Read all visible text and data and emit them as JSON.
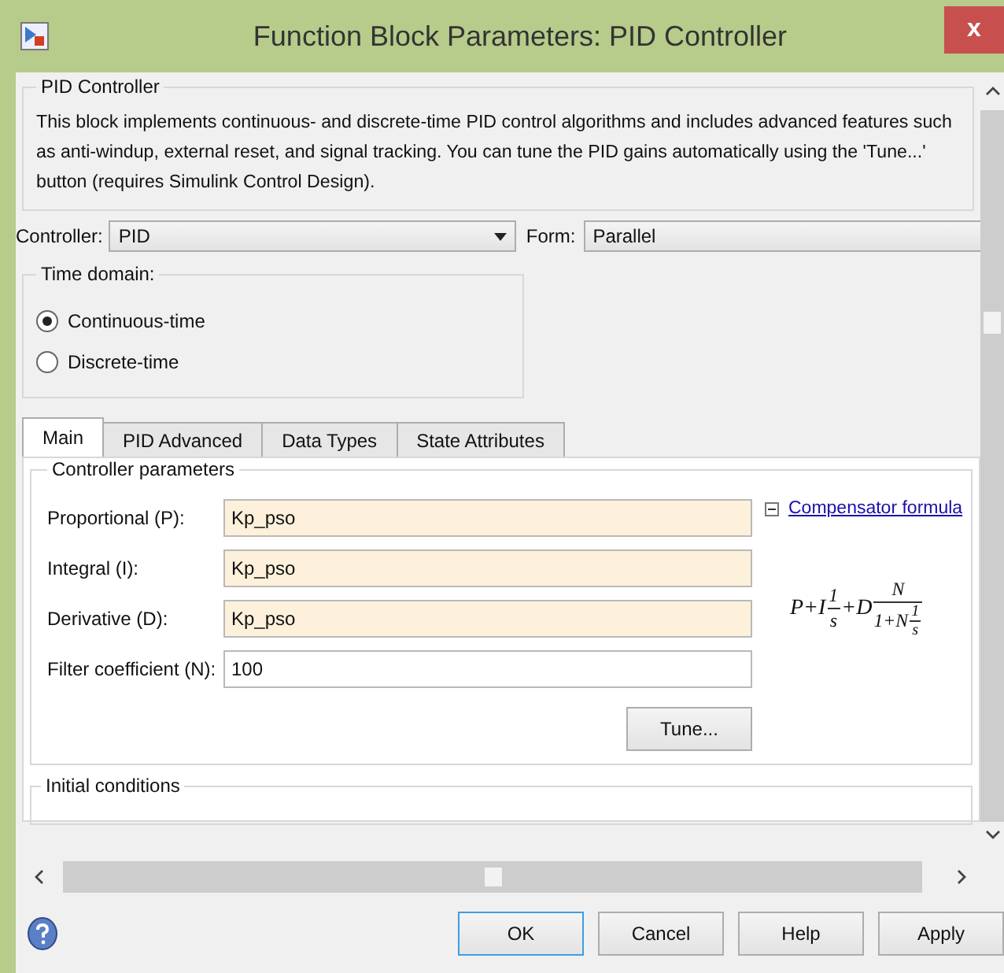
{
  "window": {
    "title": "Function Block Parameters: PID Controller",
    "close": "x"
  },
  "block": {
    "legend": "PID Controller",
    "description": "This block implements continuous- and discrete-time PID control algorithms and includes advanced features such as anti-windup, external reset, and signal tracking. You can tune the PID gains automatically using the 'Tune...' button (requires Simulink Control Design)."
  },
  "controller": {
    "label": "Controller:",
    "value": "PID"
  },
  "form": {
    "label": "Form:",
    "value": "Parallel"
  },
  "time_domain": {
    "legend": "Time domain:",
    "options": [
      {
        "label": "Continuous-time",
        "selected": true
      },
      {
        "label": "Discrete-time",
        "selected": false
      }
    ]
  },
  "tabs": [
    {
      "label": "Main",
      "selected": true
    },
    {
      "label": "PID Advanced",
      "selected": false
    },
    {
      "label": "Data Types",
      "selected": false
    },
    {
      "label": "State Attributes",
      "selected": false
    }
  ],
  "controller_parameters": {
    "legend": "Controller parameters",
    "fields": [
      {
        "label": "Proportional (P):",
        "value": "Kp_pso",
        "highlighted": true
      },
      {
        "label": "Integral (I):",
        "value": "Kp_pso",
        "highlighted": true
      },
      {
        "label": "Derivative (D):",
        "value": "Kp_pso",
        "highlighted": true
      },
      {
        "label": "Filter coefficient (N):",
        "value": "100",
        "highlighted": false
      }
    ],
    "tune_button": "Tune...",
    "compensator": {
      "link": "Compensator formula",
      "expanded": true
    },
    "formula": [
      {
        "kind": "text",
        "text": "P+I"
      },
      {
        "kind": "frac",
        "num": [
          {
            "kind": "text",
            "text": "1"
          }
        ],
        "den": [
          {
            "kind": "text",
            "text": "s"
          }
        ]
      },
      {
        "kind": "text",
        "text": "+D"
      },
      {
        "kind": "frac",
        "num": [
          {
            "kind": "text",
            "text": "N"
          }
        ],
        "den": [
          {
            "kind": "text",
            "text": "1+N"
          },
          {
            "kind": "frac",
            "num": [
              {
                "kind": "text",
                "text": "1"
              }
            ],
            "den": [
              {
                "kind": "text",
                "text": "s"
              }
            ]
          }
        ]
      }
    ]
  },
  "initial_conditions": {
    "legend": "Initial conditions"
  },
  "buttons": [
    {
      "label": "OK",
      "default": true
    },
    {
      "label": "Cancel",
      "default": false
    },
    {
      "label": "Help",
      "default": false
    },
    {
      "label": "Apply",
      "default": false
    }
  ]
}
